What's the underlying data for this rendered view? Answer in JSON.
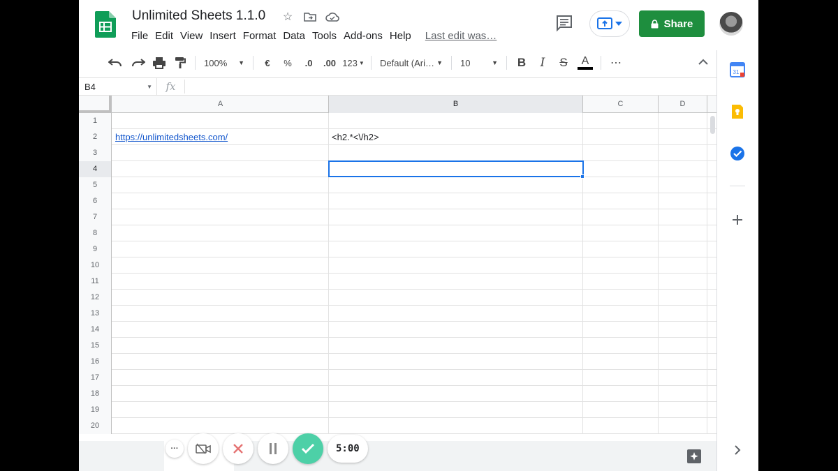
{
  "doc": {
    "title": "Unlimited Sheets 1.1.0",
    "last_edit": "Last edit was…"
  },
  "menus": [
    "File",
    "Edit",
    "View",
    "Insert",
    "Format",
    "Data",
    "Tools",
    "Add-ons",
    "Help"
  ],
  "share": {
    "label": "Share",
    "color": "#1e8e3e"
  },
  "toolbar": {
    "zoom": "100%",
    "currency": "€",
    "percent": "%",
    "decrease_decimal": ".0",
    "increase_decimal": ".00",
    "more_formats": "123",
    "font": "Default (Ari…",
    "font_size": "10",
    "bold": "B",
    "italic": "I",
    "strike": "S",
    "text_color": "A",
    "more": "⋯"
  },
  "formula_bar": {
    "cell_ref": "B4",
    "fx_label": "fx",
    "value": ""
  },
  "columns": [
    "A",
    "B",
    "C",
    "D"
  ],
  "rows": [
    {
      "n": "1",
      "a": "",
      "b": ""
    },
    {
      "n": "2",
      "a": "https://unlimitedsheets.com/",
      "b": "<h2.*<\\/h2>"
    },
    {
      "n": "3",
      "a": "",
      "b": ""
    },
    {
      "n": "4",
      "a": "",
      "b": ""
    },
    {
      "n": "5",
      "a": "",
      "b": ""
    },
    {
      "n": "6",
      "a": "",
      "b": ""
    },
    {
      "n": "7",
      "a": "",
      "b": ""
    },
    {
      "n": "8",
      "a": "",
      "b": ""
    },
    {
      "n": "9",
      "a": "",
      "b": ""
    },
    {
      "n": "10",
      "a": "",
      "b": ""
    },
    {
      "n": "11",
      "a": "",
      "b": ""
    },
    {
      "n": "12",
      "a": "",
      "b": ""
    },
    {
      "n": "13",
      "a": "",
      "b": ""
    },
    {
      "n": "14",
      "a": "",
      "b": ""
    },
    {
      "n": "15",
      "a": "",
      "b": ""
    },
    {
      "n": "16",
      "a": "",
      "b": ""
    },
    {
      "n": "17",
      "a": "",
      "b": ""
    },
    {
      "n": "18",
      "a": "",
      "b": ""
    },
    {
      "n": "19",
      "a": "",
      "b": ""
    },
    {
      "n": "20",
      "a": "",
      "b": ""
    }
  ],
  "selection": {
    "cell": "B4",
    "column": "B",
    "row": "4",
    "color": "#1a73e8"
  },
  "recorder": {
    "more": "···",
    "timer": "5:00",
    "accent": "#4dd0a7"
  },
  "side_panel": [
    "calendar-icon",
    "keep-icon",
    "tasks-icon",
    "add-icon"
  ]
}
